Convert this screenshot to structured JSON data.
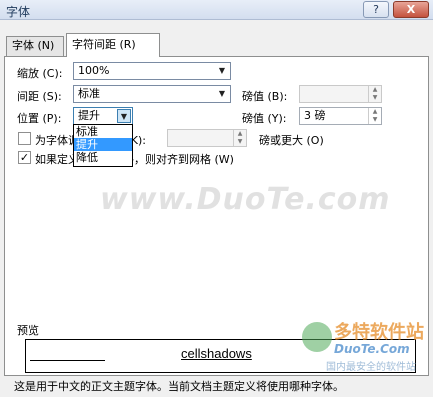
{
  "window": {
    "title": "字体",
    "help_label": "?",
    "close_label": "X"
  },
  "tabs": [
    {
      "label": "字体 (N)"
    },
    {
      "label": "字符间距 (R)"
    }
  ],
  "scale": {
    "label": "缩放 (C):",
    "value": "100%"
  },
  "spacing": {
    "label": "间距 (S):",
    "value": "标准",
    "pt_label": "磅值 (B):",
    "pt_value": ""
  },
  "position": {
    "label": "位置 (P):",
    "value": "提升",
    "pt_label": "磅值 (Y):",
    "pt_value": "3 磅",
    "options": [
      "标准",
      "提升",
      "降低"
    ],
    "selected_option": "提升"
  },
  "kerning": {
    "label": "为字体调整字间距 (K):",
    "pt_value": "",
    "suffix": "磅或更大 (O)"
  },
  "grid": {
    "label": "如果定义了文档网格，则对齐到网格 (W)",
    "checked": "✓"
  },
  "preview": {
    "section_label": "预览",
    "sample": "cellshadows"
  },
  "footer": {
    "text": "这是用于中文的正文主题字体。当前文档主题定义将使用哪种字体。"
  },
  "watermark": {
    "main": "www.DuoTe.com",
    "badge_title": "多特软件站",
    "badge_site": "DuoTe.Com",
    "badge_sub": "国内最安全的软件站"
  }
}
